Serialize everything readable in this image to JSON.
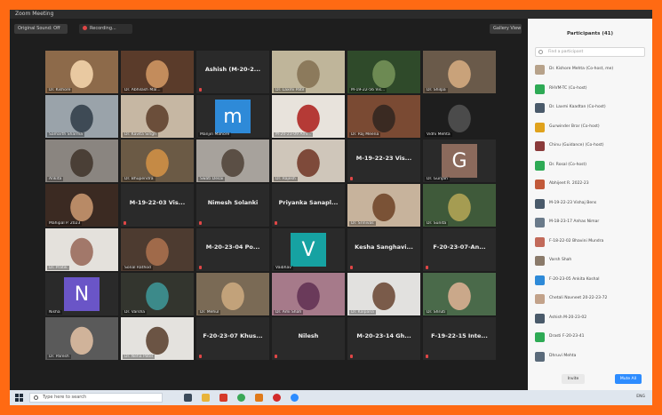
{
  "window": {
    "title": "Zoom Meeting"
  },
  "topbar": {
    "view_label": "Original Sound: Off",
    "recording_label": "Recording...",
    "view_button": "Gallery View"
  },
  "tiles": [
    {
      "name": "Dr. Kishore",
      "kind": "video",
      "bg": "#8d6a4a",
      "fg": "#e9c9a1"
    },
    {
      "name": "Dr. Abhilash Mal...",
      "kind": "video",
      "bg": "#5a3b2a",
      "fg": "#c38c5c"
    },
    {
      "name": "Ashish (M-20-2...",
      "kind": "text"
    },
    {
      "name": "Dr. Laxmi Patil",
      "kind": "video",
      "bg": "#bfb59a",
      "fg": "#8c7a5c",
      "highlight": true
    },
    {
      "name": "M-19-22-56 Vis...",
      "kind": "video",
      "bg": "#2f4a2a",
      "fg": "#6d8a53"
    },
    {
      "name": "Dr. Shilpa",
      "kind": "video",
      "bg": "#6a5a4a",
      "fg": "#c9a27a"
    },
    {
      "name": "Samarth Sharma",
      "kind": "video",
      "bg": "#9aa3aa",
      "fg": "#3e4a55"
    },
    {
      "name": "Dr. Kavita Singh",
      "kind": "video",
      "bg": "#c6b7a3",
      "fg": "#6b4e3a"
    },
    {
      "name": "Manjiri Mahore",
      "kind": "avatar",
      "letter": "m",
      "color": "#2e8ad8"
    },
    {
      "name": "M-20-23-09 Ami...",
      "kind": "video",
      "bg": "#e8e3dc",
      "fg": "#b53a36"
    },
    {
      "name": "Dr. Raj Meena",
      "kind": "video",
      "bg": "#7a4a33",
      "fg": "#3a2a22"
    },
    {
      "name": "Vidhi Mehta",
      "kind": "video",
      "bg": "#1e1e1e",
      "fg": "#4b4b4b"
    },
    {
      "name": "Ankita",
      "kind": "video",
      "bg": "#8a8580",
      "fg": "#4a3f36"
    },
    {
      "name": "Dr. Bhupendra",
      "kind": "video",
      "bg": "#6b5a45",
      "fg": "#c58a45"
    },
    {
      "name": "Swati Desai",
      "kind": "video",
      "bg": "#a7a29c",
      "fg": "#5b4f45"
    },
    {
      "name": "Dr. Rajesh",
      "kind": "video",
      "bg": "#cfc6ba",
      "fg": "#7e4a3a"
    },
    {
      "name": "M-19-22-23 Vis...",
      "kind": "text"
    },
    {
      "name": "Dr. Gunjan",
      "kind": "avatar",
      "letter": "G",
      "color": "#8b6a5c"
    },
    {
      "name": "Mahipal P. 2023",
      "kind": "video",
      "bg": "#3b2a22",
      "fg": "#b88a66"
    },
    {
      "name": "M-19-22-03 Vis...",
      "kind": "text"
    },
    {
      "name": "Nimesh Solanki",
      "kind": "text"
    },
    {
      "name": "Priyanka Sanapl...",
      "kind": "text"
    },
    {
      "name": "Dr. Srinivas",
      "kind": "video",
      "bg": "#c7b39c",
      "fg": "#7a5236"
    },
    {
      "name": "Dr. Sunita",
      "kind": "video",
      "bg": "#3f5a3a",
      "fg": "#a59c52"
    },
    {
      "name": "Dr. Pratik",
      "kind": "video",
      "bg": "#e4e1dc",
      "fg": "#a2786a"
    },
    {
      "name": "Sonal Rathod",
      "kind": "video",
      "bg": "#4d3b30",
      "fg": "#a06a4a"
    },
    {
      "name": "M-20-23-04 Po...",
      "kind": "text"
    },
    {
      "name": "Vaibhav",
      "kind": "avatar",
      "letter": "V",
      "color": "#16a2a2"
    },
    {
      "name": "Kesha Sanghavi...",
      "kind": "text"
    },
    {
      "name": "F-20-23-07-An...",
      "kind": "text"
    },
    {
      "name": "Nisha",
      "kind": "avatar",
      "letter": "N",
      "color": "#6a55c7"
    },
    {
      "name": "Dr. Varsha",
      "kind": "video",
      "bg": "#33352e",
      "fg": "#3c8a8a"
    },
    {
      "name": "Dr. Mehul",
      "kind": "video",
      "bg": "#7a6a55",
      "fg": "#c2a27a"
    },
    {
      "name": "Dr. Ami Shah",
      "kind": "video",
      "bg": "#a67a8a",
      "fg": "#6a3a5a"
    },
    {
      "name": "Dr. Kalpana",
      "kind": "video",
      "bg": "#e2e1df",
      "fg": "#7a5b4a"
    },
    {
      "name": "Dr. Shruti",
      "kind": "video",
      "bg": "#4a6a4a",
      "fg": "#caa88a"
    },
    {
      "name": "Dr. Paresh",
      "kind": "video",
      "bg": "#5a5a5a",
      "fg": "#d0b39a"
    },
    {
      "name": "Dr. Neha Patel",
      "kind": "video",
      "bg": "#e4e2de",
      "fg": "#6b5444"
    },
    {
      "name": "F-20-23-07 Khus...",
      "kind": "text"
    },
    {
      "name": "Nilesh",
      "kind": "text"
    },
    {
      "name": "M-20-23-14 Gh...",
      "kind": "text"
    },
    {
      "name": "F-19-22-15 Inte...",
      "kind": "text"
    }
  ],
  "participants_panel": {
    "title": "Participants (41)",
    "search_placeholder": "Find a participant",
    "invite_label": "Invite",
    "mute_all_label": "Mute All",
    "rows": [
      {
        "name": "Dr. Kishore Mehta (Co-host, me)",
        "color": "#b7a28a"
      },
      {
        "name": "RHVM-TC (Co-host)",
        "color": "#2eaa55"
      },
      {
        "name": "Dr. Laxmi Kaadtan (Co-host)",
        "color": "#4a5a6a"
      },
      {
        "name": "Gurwinder Brar (Co-host)",
        "color": "#e0a21c"
      },
      {
        "name": "Chinu (Guidance) (Co-host)",
        "color": "#8a3a3a"
      },
      {
        "name": "Dr. Rosal (Co-host)",
        "color": "#2eaa55"
      },
      {
        "name": "Abhijeet R. 2022-23",
        "color": "#c25a3a"
      },
      {
        "name": "M-19-22-23 Vishaj Bens",
        "color": "#4a5a6a"
      },
      {
        "name": "M-18-23-17 Anhas Nimar",
        "color": "#6a7a8a"
      },
      {
        "name": "F-18-22-02 Bhavini Mundra",
        "color": "#c26a5a"
      },
      {
        "name": "Varsh Shah",
        "color": "#8a7a6a"
      },
      {
        "name": "F-20-23-05 Ankita Koshal",
        "color": "#2e8ad8"
      },
      {
        "name": "Chetali Navneet 20-22-23-72",
        "color": "#c2a28a"
      },
      {
        "name": "Ashish M-20-23-02",
        "color": "#4a5a6a"
      },
      {
        "name": "Drasti F-20-23-41",
        "color": "#2eaa55"
      },
      {
        "name": "Dhruvi Mehta",
        "color": "#5a6a7a"
      }
    ]
  },
  "taskbar": {
    "search_placeholder": "Type here to search",
    "tray_text": "ENG",
    "icons": [
      {
        "name": "task-view-icon",
        "color": "#3a4a5a"
      },
      {
        "name": "file-explorer-icon",
        "color": "#e8b43a"
      },
      {
        "name": "acrobat-icon",
        "color": "#d63a2a"
      },
      {
        "name": "chrome-icon",
        "color": "#3aa857"
      },
      {
        "name": "media-icon",
        "color": "#e07a1a"
      },
      {
        "name": "opera-icon",
        "color": "#d22a2a"
      },
      {
        "name": "zoom-icon",
        "color": "#2d8cff"
      }
    ]
  }
}
